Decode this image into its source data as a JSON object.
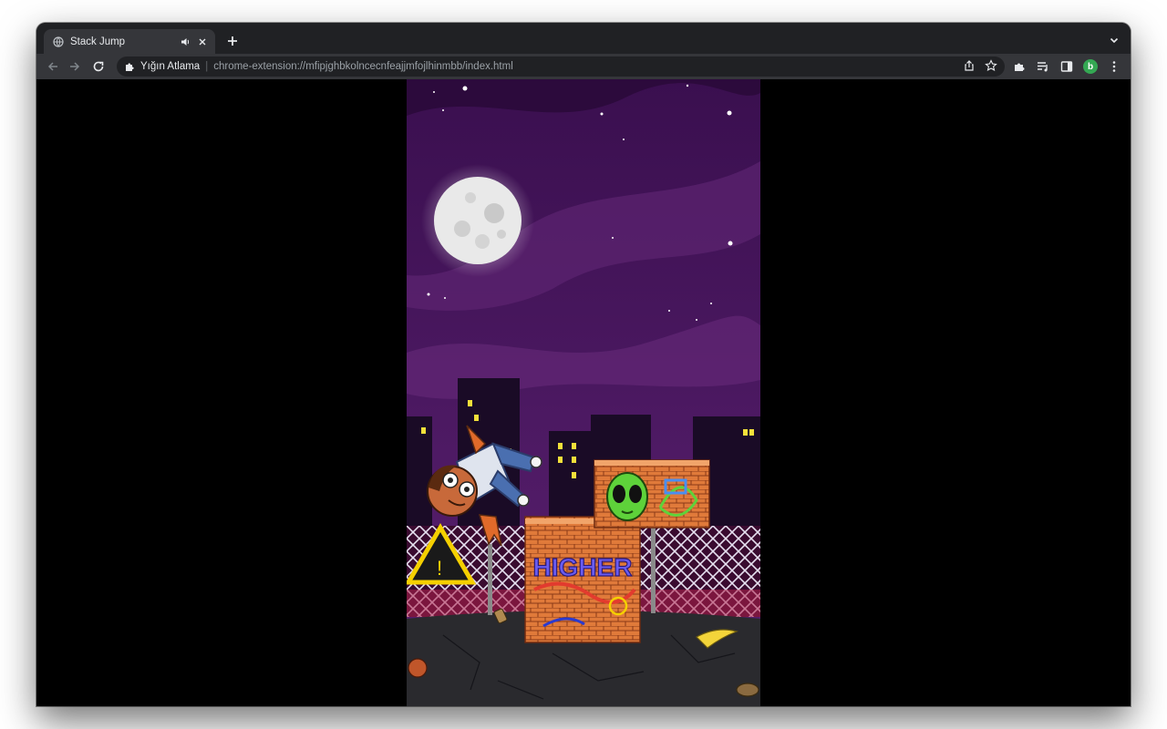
{
  "tab": {
    "title": "Stack Jump"
  },
  "address": {
    "site_name": "Yığın Atlama",
    "url": "chrome-extension://mfipjghbkolncecnfeajjmfojlhinmbb/index.html"
  },
  "profile": {
    "initial": "b"
  },
  "icons": {
    "tab_favicon": "globe-icon",
    "tab_audio": "speaker-icon",
    "tab_close": "close-icon",
    "new_tab": "plus-icon",
    "tab_search": "chevron-down-icon",
    "back": "back-arrow-icon",
    "forward": "forward-arrow-icon",
    "reload": "reload-icon",
    "omnibox_extension": "puzzle-icon",
    "share": "share-icon",
    "bookmark": "star-icon",
    "extensions": "puzzle-icon",
    "media": "media-queue-icon",
    "side_panel": "side-panel-icon",
    "menu": "kebab-menu-icon"
  },
  "game": {
    "sign_graffiti": "HIGHER"
  },
  "colors": {
    "tabstrip": "#202124",
    "toolbar": "#35363a",
    "sky_top": "#3a0f4f",
    "sky_bottom": "#5a1f6e",
    "brick": "#e07a3a",
    "profile": "#34a853"
  }
}
